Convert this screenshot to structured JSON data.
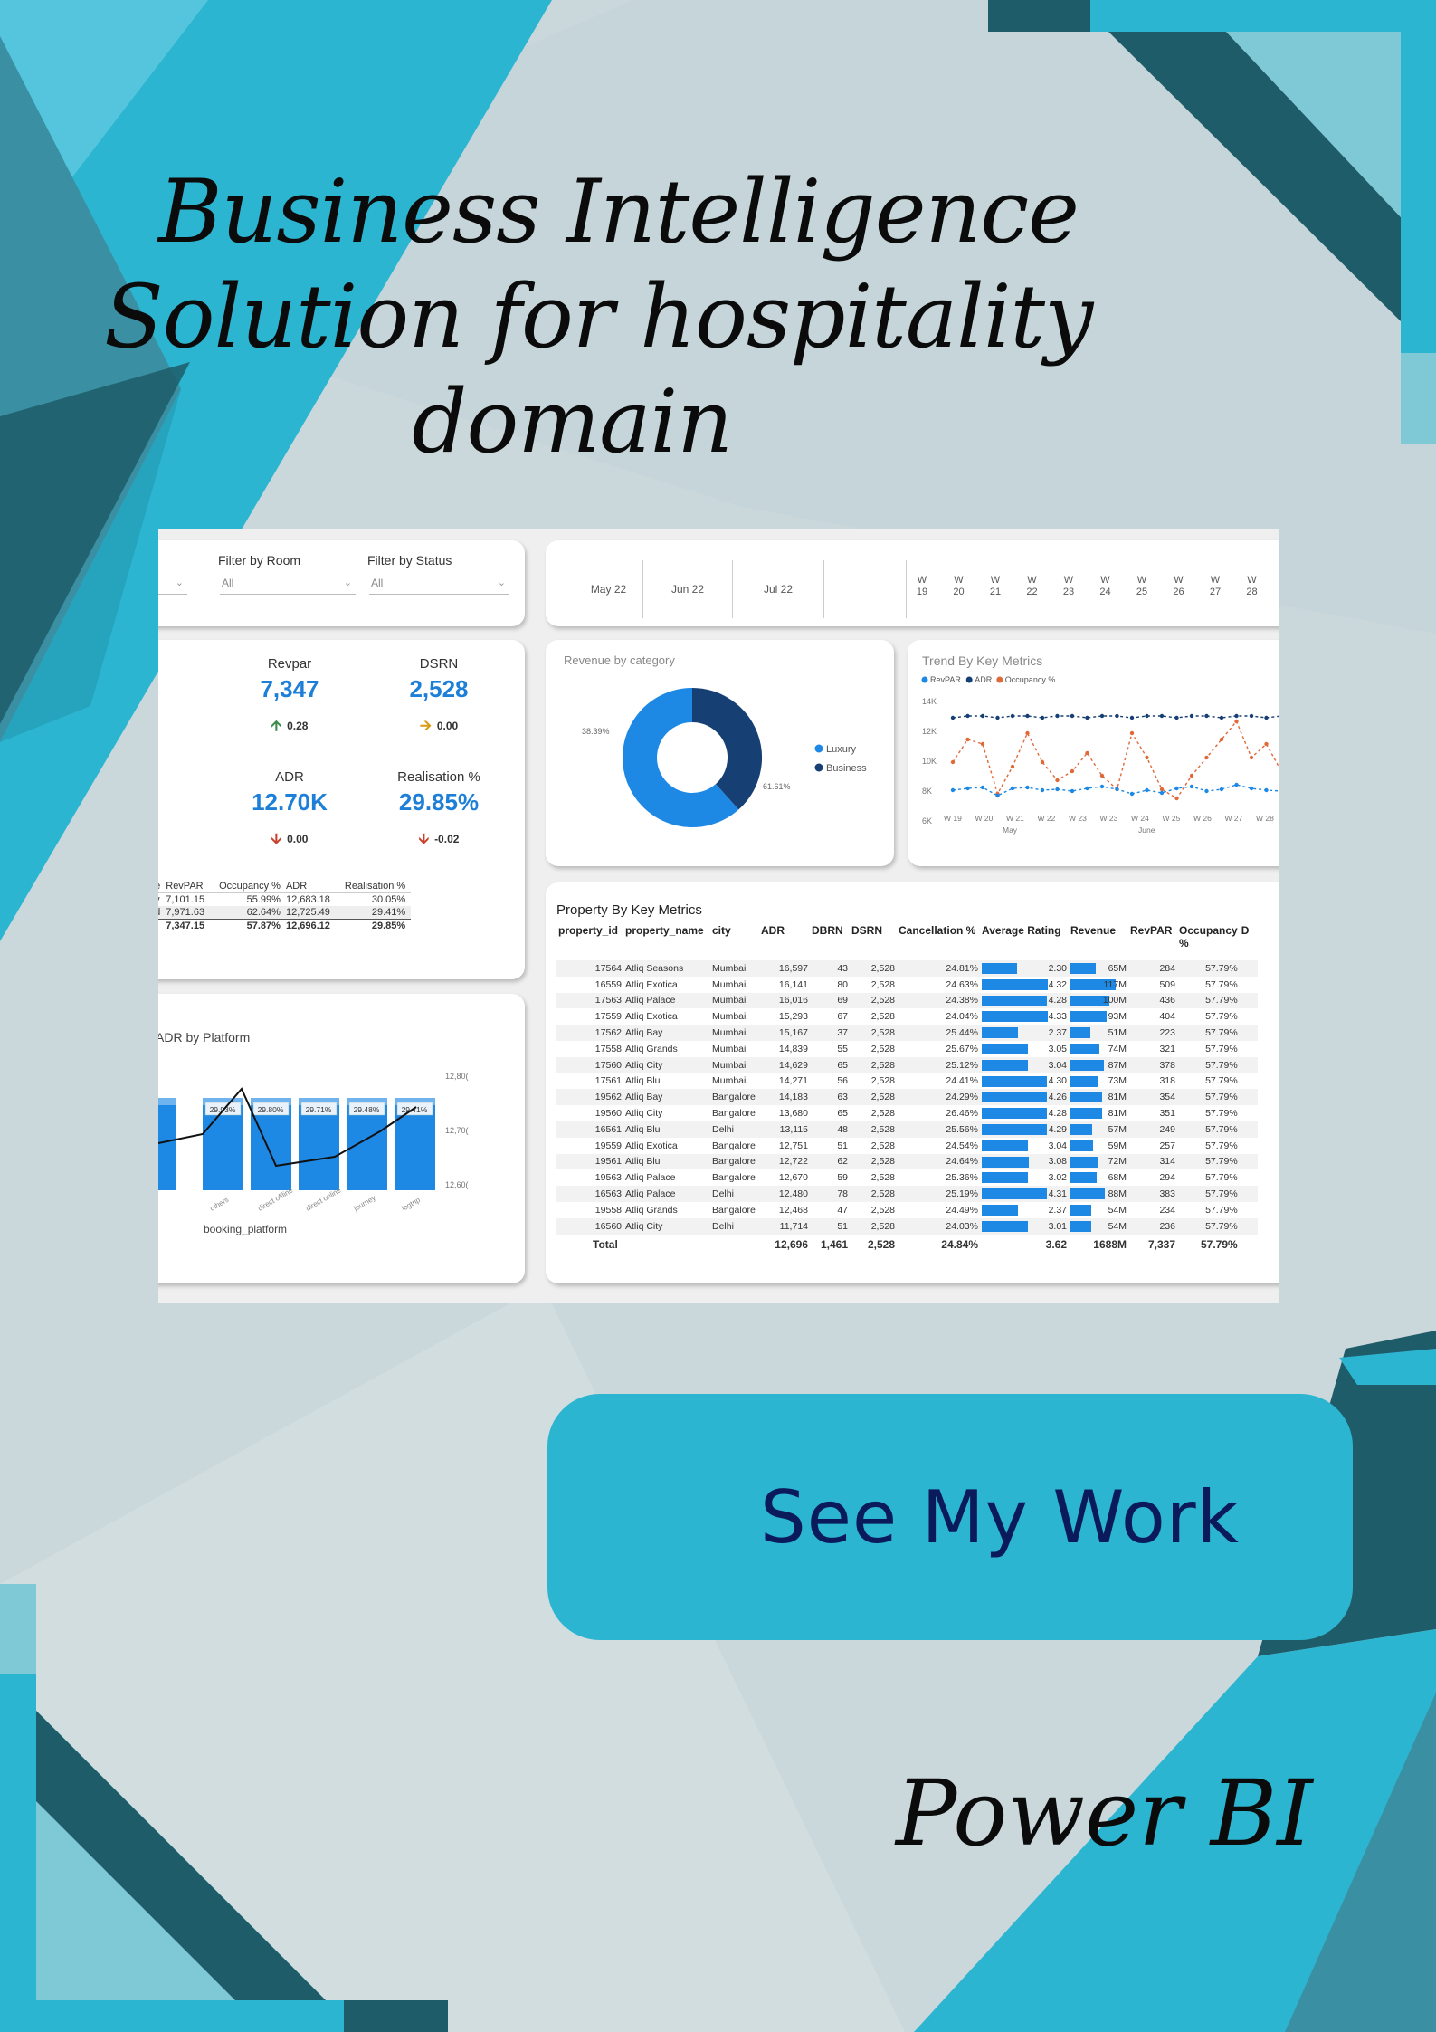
{
  "poster": {
    "title_lines": [
      "Business Intelligence",
      "Solution for hospitality",
      "domain"
    ],
    "cta_label": "See My Work",
    "tool_label": "Power BI",
    "colors": {
      "accent": "#2cb5d1",
      "dark_teal": "#1e5c69",
      "background": "#cdd9dc",
      "cta_text": "#0b1a5a"
    }
  },
  "dashboard": {
    "filters": {
      "room_label": "Filter by Room",
      "room_value": "All",
      "status_label": "Filter by Status",
      "status_value": "All",
      "chevron_icon": "chevron-down-icon"
    },
    "timeline": {
      "months": [
        "May 22",
        "Jun 22",
        "Jul 22"
      ],
      "weeks": [
        [
          "W",
          "19"
        ],
        [
          "W",
          "20"
        ],
        [
          "W",
          "21"
        ],
        [
          "W",
          "22"
        ],
        [
          "W",
          "23"
        ],
        [
          "W",
          "24"
        ],
        [
          "W",
          "25"
        ],
        [
          "W",
          "26"
        ],
        [
          "W",
          "27"
        ],
        [
          "W",
          "28"
        ]
      ]
    },
    "kpis": [
      {
        "label": "Revpar",
        "value": "7,347",
        "delta": "0.28",
        "direction": "up"
      },
      {
        "label": "DSRN",
        "value": "2,528",
        "delta": "0.00",
        "direction": "right"
      },
      {
        "label": "ADR",
        "value": "12.70K",
        "delta": "0.00",
        "direction": "down"
      },
      {
        "label": "Realisation %",
        "value": "29.85%",
        "delta": "-0.02",
        "direction": "down"
      }
    ],
    "summary_table": {
      "headers": [
        "pe",
        "RevPAR",
        "Occupancy %",
        "ADR",
        "Realisation %"
      ],
      "rows": [
        [
          "ay",
          "7,101.15",
          "55.99%",
          "12,683.18",
          "30.05%"
        ],
        [
          "nd",
          "7,971.63",
          "62.64%",
          "12,725.49",
          "29.41%"
        ],
        [
          "",
          "7,347.15",
          "57.87%",
          "12,696.12",
          "29.85%"
        ]
      ]
    },
    "revenue_by_category": {
      "title": "Revenue by category",
      "slices": [
        {
          "name": "Luxury",
          "value": 61.61,
          "label": "61.61%",
          "color": "#1e88e5"
        },
        {
          "name": "Business",
          "value": 38.39,
          "label": "38.39%",
          "color": "#163f73"
        }
      ]
    },
    "trend_chart": {
      "title": "Trend By Key Metrics",
      "legend": [
        "RevPAR",
        "ADR",
        "Occupancy %"
      ],
      "y_ticks": [
        "14K",
        "12K",
        "10K",
        "8K",
        "6K"
      ],
      "x_ticks": [
        "W 19",
        "W 20",
        "W 21",
        "W 22",
        "W 23",
        "W 23",
        "W 24",
        "W 25",
        "W 26",
        "W 27",
        "W 28",
        "W 2"
      ],
      "x_group_labels": [
        "May",
        "June"
      ]
    },
    "platform_chart": {
      "title": "ADR by Platform",
      "x_label": "booking_platform",
      "categories": [
        "others",
        "direct offline",
        "direct online",
        "journey",
        "logtrip"
      ],
      "bar_labels": [
        "29.93%",
        "29.80%",
        "29.71%",
        "29.48%",
        "29.41%"
      ],
      "right_ticks": [
        "12,80(",
        "12,70(",
        "12,60("
      ]
    },
    "property_table": {
      "title": "Property By Key Metrics",
      "headers": [
        "property_id",
        "property_name",
        "city",
        "ADR",
        "DBRN",
        "DSRN",
        "Cancellation %",
        "Average Rating",
        "Revenue",
        "RevPAR",
        "Occupancy %",
        "D"
      ],
      "rows": [
        [
          "17564",
          "Atliq Seasons",
          "Mumbai",
          "16,597",
          "43",
          "2,528",
          "24.81%",
          "2.30",
          "65M",
          "284",
          "57.79%"
        ],
        [
          "16559",
          "Atliq Exotica",
          "Mumbai",
          "16,141",
          "80",
          "2,528",
          "24.63%",
          "4.32",
          "117M",
          "509",
          "57.79%"
        ],
        [
          "17563",
          "Atliq Palace",
          "Mumbai",
          "16,016",
          "69",
          "2,528",
          "24.38%",
          "4.28",
          "100M",
          "436",
          "57.79%"
        ],
        [
          "17559",
          "Atliq Exotica",
          "Mumbai",
          "15,293",
          "67",
          "2,528",
          "24.04%",
          "4.33",
          "93M",
          "404",
          "57.79%"
        ],
        [
          "17562",
          "Atliq Bay",
          "Mumbai",
          "15,167",
          "37",
          "2,528",
          "25.44%",
          "2.37",
          "51M",
          "223",
          "57.79%"
        ],
        [
          "17558",
          "Atliq Grands",
          "Mumbai",
          "14,839",
          "55",
          "2,528",
          "25.67%",
          "3.05",
          "74M",
          "321",
          "57.79%"
        ],
        [
          "17560",
          "Atliq City",
          "Mumbai",
          "14,629",
          "65",
          "2,528",
          "25.12%",
          "3.04",
          "87M",
          "378",
          "57.79%"
        ],
        [
          "17561",
          "Atliq Blu",
          "Mumbai",
          "14,271",
          "56",
          "2,528",
          "24.41%",
          "4.30",
          "73M",
          "318",
          "57.79%"
        ],
        [
          "19562",
          "Atliq Bay",
          "Bangalore",
          "14,183",
          "63",
          "2,528",
          "24.29%",
          "4.26",
          "81M",
          "354",
          "57.79%"
        ],
        [
          "19560",
          "Atliq City",
          "Bangalore",
          "13,680",
          "65",
          "2,528",
          "26.46%",
          "4.28",
          "81M",
          "351",
          "57.79%"
        ],
        [
          "16561",
          "Atliq Blu",
          "Delhi",
          "13,115",
          "48",
          "2,528",
          "25.56%",
          "4.29",
          "57M",
          "249",
          "57.79%"
        ],
        [
          "19559",
          "Atliq Exotica",
          "Bangalore",
          "12,751",
          "51",
          "2,528",
          "24.54%",
          "3.04",
          "59M",
          "257",
          "57.79%"
        ],
        [
          "19561",
          "Atliq Blu",
          "Bangalore",
          "12,722",
          "62",
          "2,528",
          "24.64%",
          "3.08",
          "72M",
          "314",
          "57.79%"
        ],
        [
          "19563",
          "Atliq Palace",
          "Bangalore",
          "12,670",
          "59",
          "2,528",
          "25.36%",
          "3.02",
          "68M",
          "294",
          "57.79%"
        ],
        [
          "16563",
          "Atliq Palace",
          "Delhi",
          "12,480",
          "78",
          "2,528",
          "25.19%",
          "4.31",
          "88M",
          "383",
          "57.79%"
        ],
        [
          "19558",
          "Atliq Grands",
          "Bangalore",
          "12,468",
          "47",
          "2,528",
          "24.49%",
          "2.37",
          "54M",
          "234",
          "57.79%"
        ],
        [
          "16560",
          "Atliq City",
          "Delhi",
          "11,714",
          "51",
          "2,528",
          "24.03%",
          "3.01",
          "54M",
          "236",
          "57.79%"
        ]
      ],
      "total": [
        "Total",
        "",
        "",
        "12,696",
        "1,461",
        "2,528",
        "24.84%",
        "3.62",
        "1688M",
        "7,337",
        "57.79%"
      ]
    }
  }
}
